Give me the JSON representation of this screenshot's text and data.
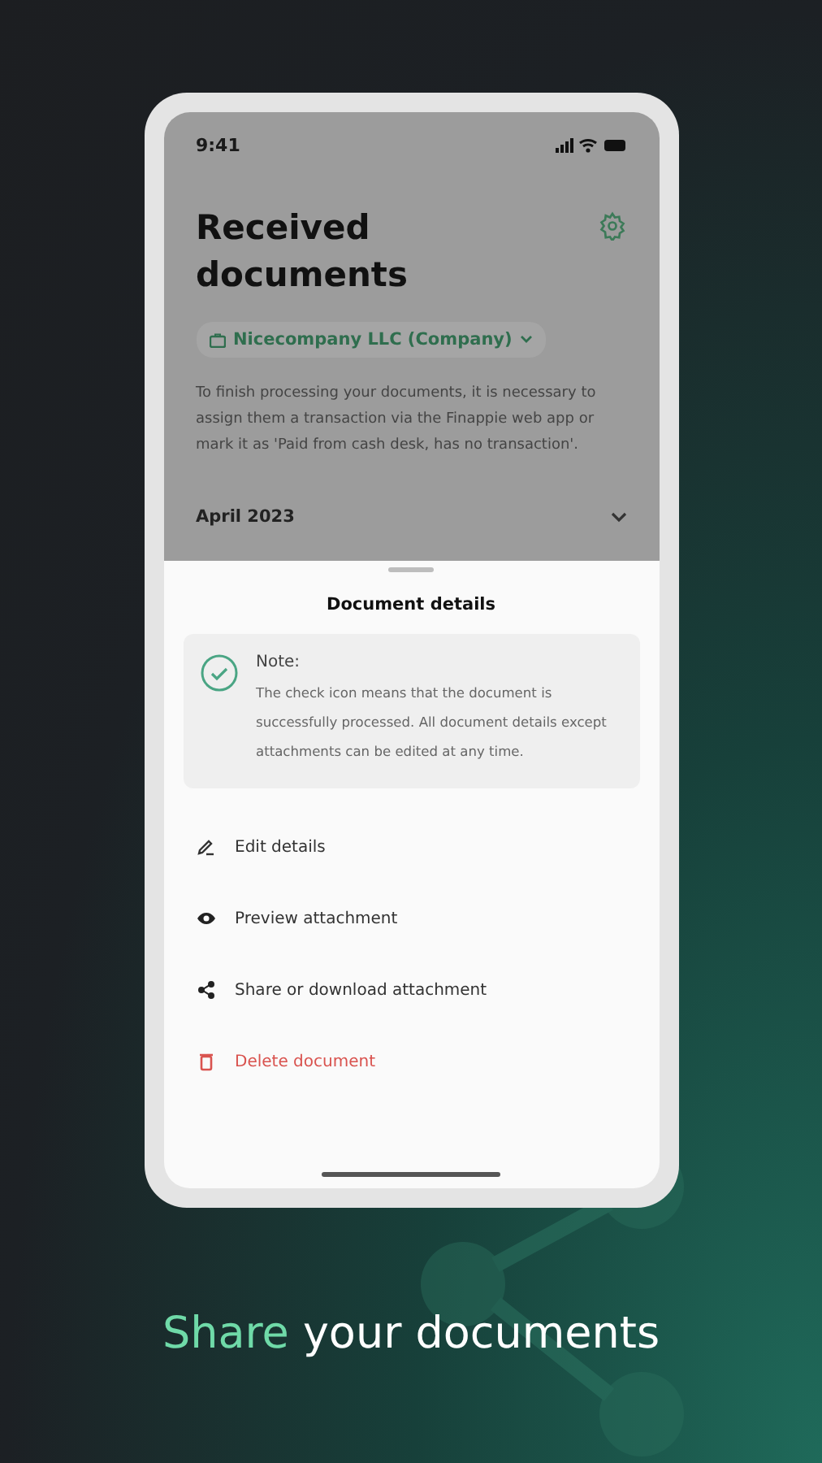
{
  "status_bar": {
    "time": "9:41"
  },
  "screen": {
    "title": "Received documents",
    "company": "Nicecompany LLC (Company)",
    "info": "To finish processing your documents, it is necessary to assign them a transaction via the Finappie web app or mark it as 'Paid from cash desk, has no transaction'.",
    "month": "April 2023"
  },
  "sheet": {
    "title": "Document details",
    "note": {
      "title": "Note:",
      "text": "The check icon means that the document is successfully processed. All document details except attachments can be edited at any time."
    },
    "actions": [
      {
        "kind": "edit",
        "label": "Edit details"
      },
      {
        "kind": "preview",
        "label": "Preview attachment"
      },
      {
        "kind": "share",
        "label": "Share or download attachment"
      },
      {
        "kind": "delete",
        "label": "Delete document"
      }
    ]
  },
  "caption": {
    "highlight": "Share",
    "rest": "your documents"
  }
}
